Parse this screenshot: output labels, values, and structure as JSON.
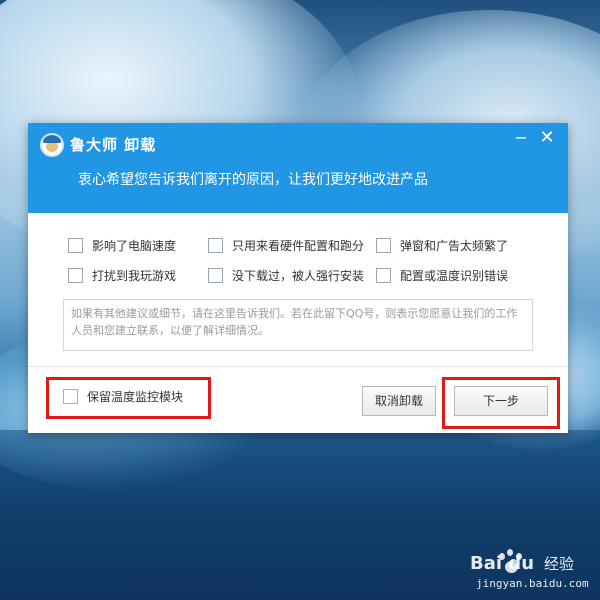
{
  "dialog": {
    "title": "鲁大师 卸载",
    "minimize_glyph": "−",
    "close_glyph": "✕",
    "subtitle": "衷心希望您告诉我们离开的原因，让我们更好地改进产品"
  },
  "reasons": [
    {
      "label": "影响了电脑速度",
      "checked": false
    },
    {
      "label": "只用来看硬件配置和跑分",
      "checked": false
    },
    {
      "label": "弹窗和广告太频繁了",
      "checked": false
    },
    {
      "label": "打扰到我玩游戏",
      "checked": false
    },
    {
      "label": "没下载过，被人强行安装",
      "checked": false
    },
    {
      "label": "配置或温度识别错误",
      "checked": false
    }
  ],
  "feedback": {
    "placeholder": "如果有其他建议或细节，请在这里告诉我们。若在此留下QQ号，则表示您愿意让我们的工作人员和您建立联系，以便了解详细情况。"
  },
  "footer": {
    "keep_label": "保留温度监控模块",
    "keep_checked": false,
    "cancel_label": "取消卸载",
    "next_label": "下一步"
  },
  "watermark": {
    "logo": "Bai du",
    "jingyan": "经验",
    "url": "jingyan.baidu.com"
  },
  "colors": {
    "header": "#2196e5",
    "annotation": "#e01818"
  }
}
